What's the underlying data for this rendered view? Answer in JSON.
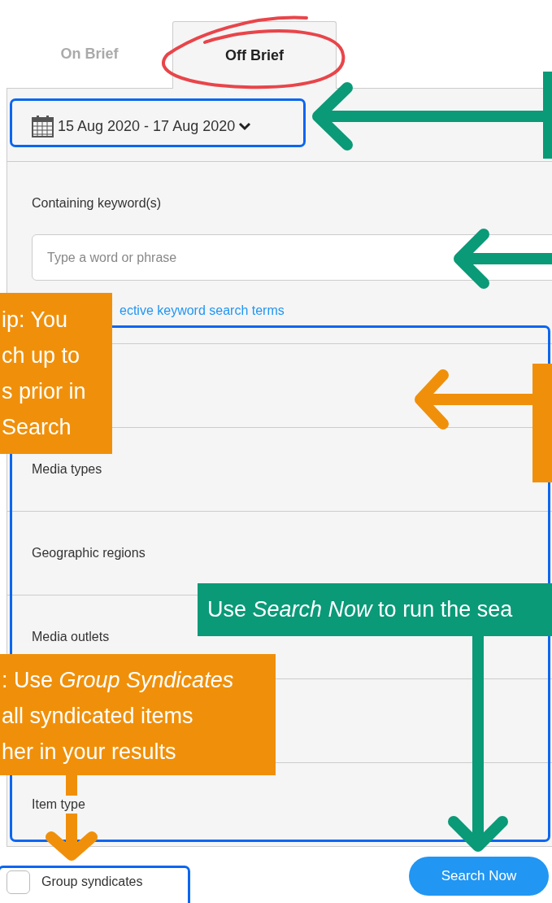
{
  "tabs": [
    {
      "label": "On Brief",
      "selected": false
    },
    {
      "label": "Off Brief",
      "selected": true
    }
  ],
  "date_range": {
    "value": "15 Aug 2020 - 17 Aug 2020"
  },
  "keywords": {
    "label": "Containing keyword(s)",
    "placeholder": "Type a word or phrase",
    "help_link": "ective keyword search terms"
  },
  "filters": [
    {
      "kind": "blank"
    },
    {
      "kind": "labeled",
      "label": "Media types"
    },
    {
      "kind": "labeled",
      "label": "Geographic regions"
    },
    {
      "kind": "labeled",
      "label": "Media outlets"
    },
    {
      "kind": "blank"
    },
    {
      "kind": "labeled",
      "label": "Item type"
    }
  ],
  "group_syndicates": {
    "label": "Group syndicates",
    "checked": false
  },
  "search_button": "Search Now",
  "annotations": {
    "tip_top": [
      "ip: You",
      "ch up to",
      "s prior in",
      "Search"
    ],
    "tip_bottom": [
      ": Use *Group Syndicates*",
      "all syndicated items",
      "her in your results"
    ],
    "callout": "Use *Search Now* to run the sea"
  }
}
